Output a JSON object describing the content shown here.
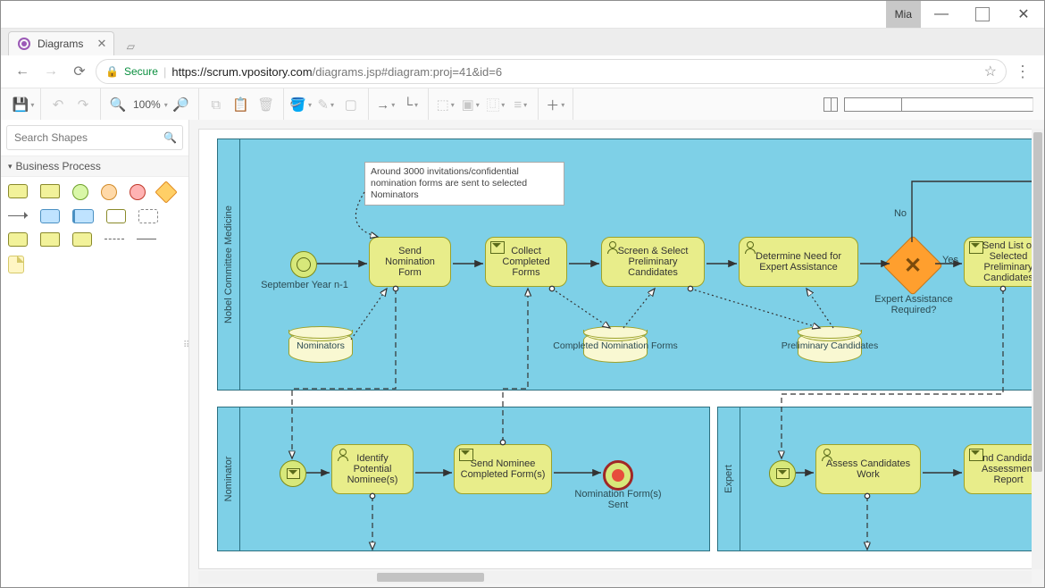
{
  "window": {
    "user_badge": "Mia",
    "tab_title": "Diagrams",
    "url_secure_label": "Secure",
    "url_host": "https://scrum.vpository.com",
    "url_path": "/diagrams.jsp#diagram:proj=41&id=6",
    "zoom_label": "100%"
  },
  "sidebar": {
    "search_placeholder": "Search Shapes",
    "palette_title": "Business Process"
  },
  "diagram": {
    "pools": {
      "top": "Nobel Committee Medicine",
      "bottom_left": "Nominator",
      "bottom_right": "Expert"
    },
    "note_text": "Around 3000 invitations/confidential nomination forms are sent to selected Nominators",
    "start_event_label": "September Year n-1",
    "tasks": {
      "t1": "Send Nomination Form",
      "t2": "Collect Completed Forms",
      "t3": "Screen & Select  Preliminary Candidates",
      "t4": "Determine Need for Expert Assistance",
      "t5": "Send List of Selected Preliminary Candidates",
      "n1": "Identify Potential Nominee(s)",
      "n2": "Send Nominee Completed Form(s)",
      "e1": "Assess Candidates Work",
      "e2": "Send Candidates Assessment Report"
    },
    "gateway_label": "Expert Assistance Required?",
    "gateway_no": "No",
    "gateway_yes": "Yes",
    "end_event_label": "Nomination Form(s) Sent",
    "datastores": {
      "d1": "Nominators",
      "d2": "Completed Nomination Forms",
      "d3": "Preliminary Candidates"
    }
  }
}
